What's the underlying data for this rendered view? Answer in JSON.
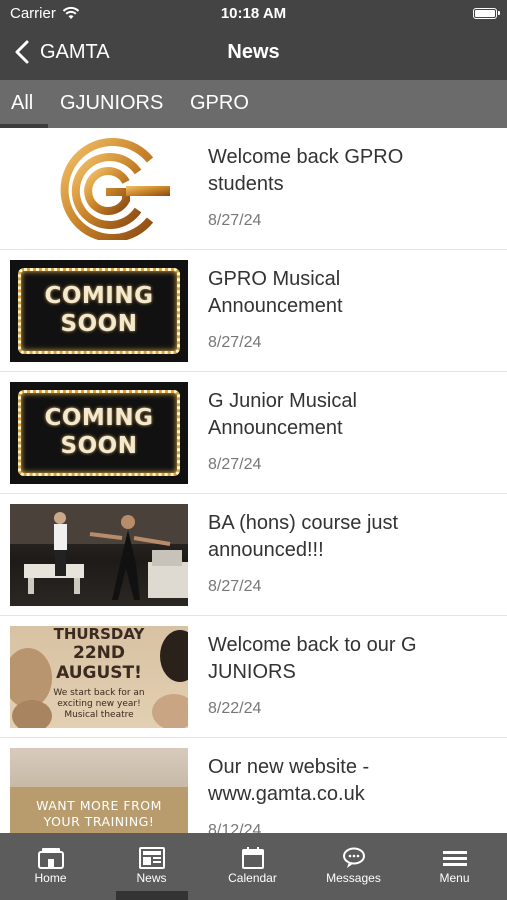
{
  "status": {
    "carrier": "Carrier",
    "time": "10:18 AM"
  },
  "nav": {
    "back_label": "GAMTA",
    "title": "News"
  },
  "tabs": [
    {
      "label": "All",
      "active": true
    },
    {
      "label": "GJUNIORS",
      "active": false
    },
    {
      "label": "GPRO",
      "active": false
    }
  ],
  "news": [
    {
      "headline": "Welcome back GPRO students",
      "date": "8/27/24",
      "thumb": "gamta-logo"
    },
    {
      "headline": "GPRO Musical Announcement",
      "date": "8/27/24",
      "thumb": "coming-soon",
      "thumb_text": [
        "COMING",
        "SOON"
      ]
    },
    {
      "headline": "G Junior Musical Announcement",
      "date": "8/27/24",
      "thumb": "coming-soon",
      "thumb_text": [
        "COMING",
        "SOON"
      ]
    },
    {
      "headline": "BA (hons) course just announced!!!",
      "date": "8/27/24",
      "thumb": "dance-photo"
    },
    {
      "headline": "Welcome back to our G JUNIORS",
      "date": "8/22/24",
      "thumb": "poster",
      "thumb_text": [
        "THURSDAY",
        "22ND",
        "AUGUST!",
        "We start back for an",
        "exciting new year!",
        "Musical theatre"
      ]
    },
    {
      "headline": "Our new website - www.gamta.co.uk",
      "date": "8/12/24",
      "thumb": "website-promo",
      "thumb_text": [
        "WANT MORE FROM",
        "YOUR TRAINING!"
      ]
    }
  ],
  "bottom_tabs": [
    {
      "label": "Home",
      "icon": "home-icon"
    },
    {
      "label": "News",
      "icon": "news-icon",
      "active": true
    },
    {
      "label": "Calendar",
      "icon": "calendar-icon"
    },
    {
      "label": "Messages",
      "icon": "messages-icon"
    },
    {
      "label": "Menu",
      "icon": "menu-icon"
    }
  ],
  "colors": {
    "nav_bg": "#444444",
    "tabs_bg": "#6b6b6b",
    "bottom_bg": "#5c5c5c",
    "text": "#333333",
    "date": "#777777"
  }
}
